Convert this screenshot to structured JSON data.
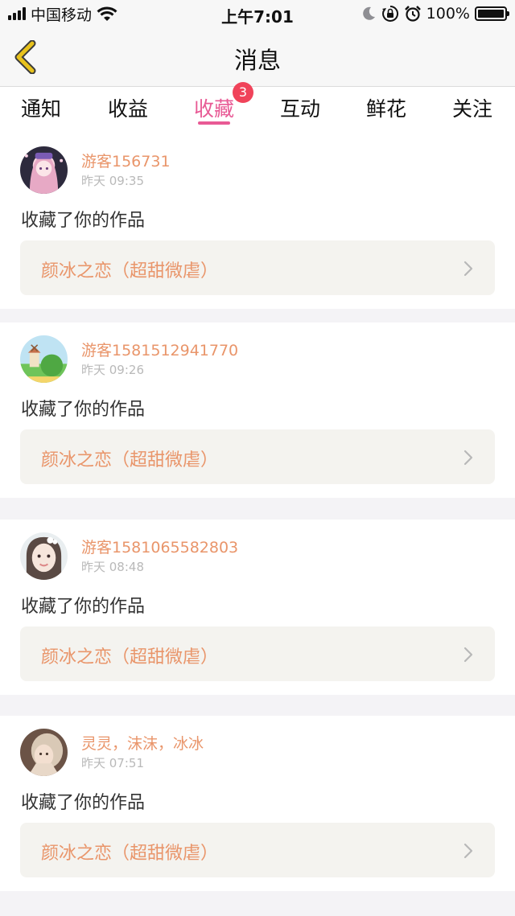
{
  "status_bar": {
    "carrier": "中国移动",
    "time": "上午7:01",
    "battery_percent": "100%",
    "battery_level": 1.0,
    "icons": [
      "signal-icon",
      "wifi-icon",
      "moon-icon",
      "orientation-lock-icon",
      "alarm-icon",
      "battery-icon"
    ]
  },
  "nav": {
    "title": "消息",
    "back_icon": "chevron-left-icon"
  },
  "tabs": [
    {
      "label": "通知"
    },
    {
      "label": "收益"
    },
    {
      "label": "收藏",
      "active": true,
      "badge": "3"
    },
    {
      "label": "互动"
    },
    {
      "label": "鲜花"
    },
    {
      "label": "关注"
    }
  ],
  "messages": [
    {
      "user": "游客156731",
      "time": "昨天 09:35",
      "action": "收藏了你的作品",
      "work": "颜冰之恋（超甜微虐）"
    },
    {
      "user": "游客1581512941770",
      "time": "昨天 09:26",
      "action": "收藏了你的作品",
      "work": "颜冰之恋（超甜微虐）"
    },
    {
      "user": "游客1581065582803",
      "time": "昨天 08:48",
      "action": "收藏了你的作品",
      "work": "颜冰之恋（超甜微虐）"
    },
    {
      "user": "灵灵，沫沫，冰冰",
      "time": "昨天 07:51",
      "action": "收藏了你的作品",
      "work": "颜冰之恋（超甜微虐）"
    }
  ],
  "colors": {
    "accent_pink": "#e85a95",
    "badge_red": "#f0435a",
    "name_orange": "#e9956a",
    "back_yellow": "#e8c21c"
  }
}
